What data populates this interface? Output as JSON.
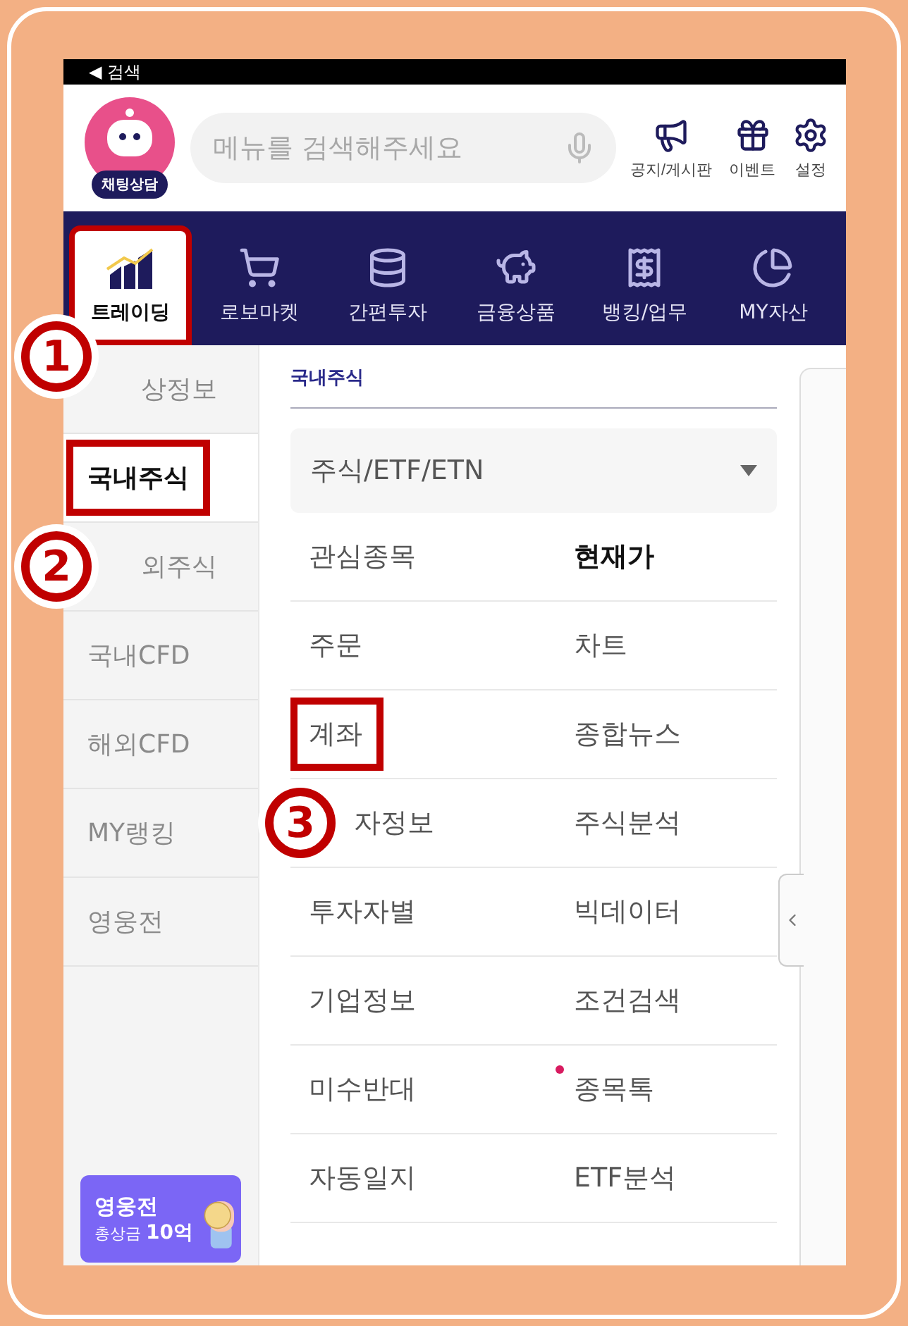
{
  "status_bar": {
    "back_label": "◀ 검색"
  },
  "header": {
    "chat": {
      "label": "채팅상담"
    },
    "search": {
      "placeholder": "메뉴를 검색해주세요"
    },
    "actions": [
      {
        "kind": "notice",
        "label": "공지/게시판"
      },
      {
        "kind": "event",
        "label": "이벤트"
      },
      {
        "kind": "settings",
        "label": "설정"
      }
    ]
  },
  "tabs": [
    {
      "kind": "trading",
      "label": "트레이딩",
      "selected": true,
      "highlighted": true
    },
    {
      "kind": "cart",
      "label": "로보마켓",
      "selected": false,
      "highlighted": false
    },
    {
      "kind": "coins",
      "label": "간편투자",
      "selected": false,
      "highlighted": false
    },
    {
      "kind": "piggy",
      "label": "금융상품",
      "selected": false,
      "highlighted": false
    },
    {
      "kind": "bank",
      "label": "뱅킹/업무",
      "selected": false,
      "highlighted": false
    },
    {
      "kind": "asset",
      "label": "MY자산",
      "selected": false,
      "highlighted": false
    }
  ],
  "sidebar": {
    "items": [
      {
        "label": "상정보",
        "selected": false,
        "highlighted": false,
        "marker": "1"
      },
      {
        "label": "국내주식",
        "selected": true,
        "highlighted": true
      },
      {
        "label": "외주식",
        "selected": false,
        "highlighted": false,
        "marker": "2"
      },
      {
        "label": "국내CFD",
        "selected": false,
        "highlighted": false
      },
      {
        "label": "해외CFD",
        "selected": false,
        "highlighted": false
      },
      {
        "label": "MY랭킹",
        "selected": false,
        "highlighted": false
      },
      {
        "label": "영웅전",
        "selected": false,
        "highlighted": false
      }
    ],
    "banner": {
      "title": "영웅전",
      "subtitle": "총상금 **10억**"
    }
  },
  "section": {
    "title": "국내주식",
    "dropdown": "주식/ETF/ETN",
    "menu": [
      {
        "label": "관심종목",
        "bold": false,
        "highlighted": false
      },
      {
        "label": "현재가",
        "bold": true,
        "highlighted": false
      },
      {
        "label": "주문",
        "bold": false,
        "highlighted": false
      },
      {
        "label": "차트",
        "bold": false,
        "highlighted": false
      },
      {
        "label": "계좌",
        "bold": false,
        "highlighted": true
      },
      {
        "label": "종합뉴스",
        "bold": false,
        "highlighted": false
      },
      {
        "label": "자정보",
        "bold": false,
        "highlighted": false,
        "marker": "3"
      },
      {
        "label": "주식분석",
        "bold": false,
        "highlighted": false
      },
      {
        "label": "투자자별",
        "bold": false,
        "highlighted": false
      },
      {
        "label": "빅데이터",
        "bold": false,
        "highlighted": false
      },
      {
        "label": "기업정보",
        "bold": false,
        "highlighted": false
      },
      {
        "label": "조건검색",
        "bold": false,
        "highlighted": false
      },
      {
        "label": "미수반대",
        "bold": false,
        "highlighted": false
      },
      {
        "label": "종목톡",
        "bold": false,
        "highlighted": false,
        "new_dot": true
      },
      {
        "label": "자동일지",
        "bold": false,
        "highlighted": false
      },
      {
        "label": "ETF분석",
        "bold": false,
        "highlighted": false
      }
    ]
  }
}
